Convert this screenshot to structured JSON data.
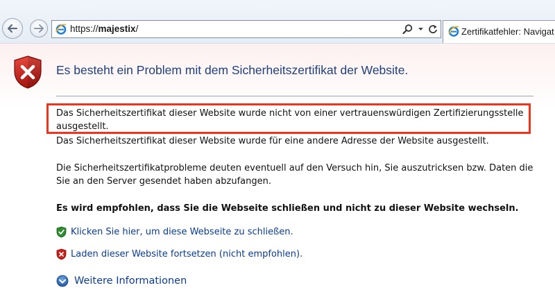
{
  "browser": {
    "address_url_prefix": "https://",
    "address_url_host": "majestix",
    "address_url_suffix": "/",
    "tab_title": "Zertifikatfehler: Navigat"
  },
  "page": {
    "title": "Es besteht ein Problem mit dem Sicherheitszertifikat der Website.",
    "paragraph_untrusted_ca": "Das Sicherheitszertifikat dieser Website wurde nicht von einer vertrauenswürdigen Zertifizierungsstelle ausgestellt.",
    "paragraph_other_address": "Das Sicherheitszertifikat dieser Website wurde für eine andere Adresse der Website ausgestellt.",
    "paragraph_warning": "Die Sicherheitszertifikatprobleme deuten eventuell auf den Versuch hin, Sie auszutricksen bzw. Daten die Sie an den Server gesendet haben abzufangen.",
    "recommendation": "Es wird empfohlen, dass Sie die Webseite schließen und nicht zu dieser Website wechseln.",
    "link_close": "Klicken Sie hier, um diese Webseite zu schließen.",
    "link_continue": "Laden dieser Website fortsetzen (nicht empfohlen).",
    "link_more_info": "Weitere Informationen"
  },
  "colors": {
    "highlight_border": "#f0341c",
    "title_blue": "#1f3f7f",
    "link_blue": "#0a3c94",
    "shield_red": "#c8221c",
    "shield_green": "#2e8b2e"
  },
  "icons": {
    "back": "back-arrow-icon",
    "forward": "forward-arrow-icon",
    "browser": "ie-logo-icon",
    "search": "search-icon",
    "dropdown": "chevron-down-icon",
    "refresh": "refresh-icon",
    "error_shield": "error-shield-icon",
    "safe_shield": "green-shield-icon",
    "unsafe_shield": "red-shield-icon",
    "expand": "expand-circle-icon"
  }
}
